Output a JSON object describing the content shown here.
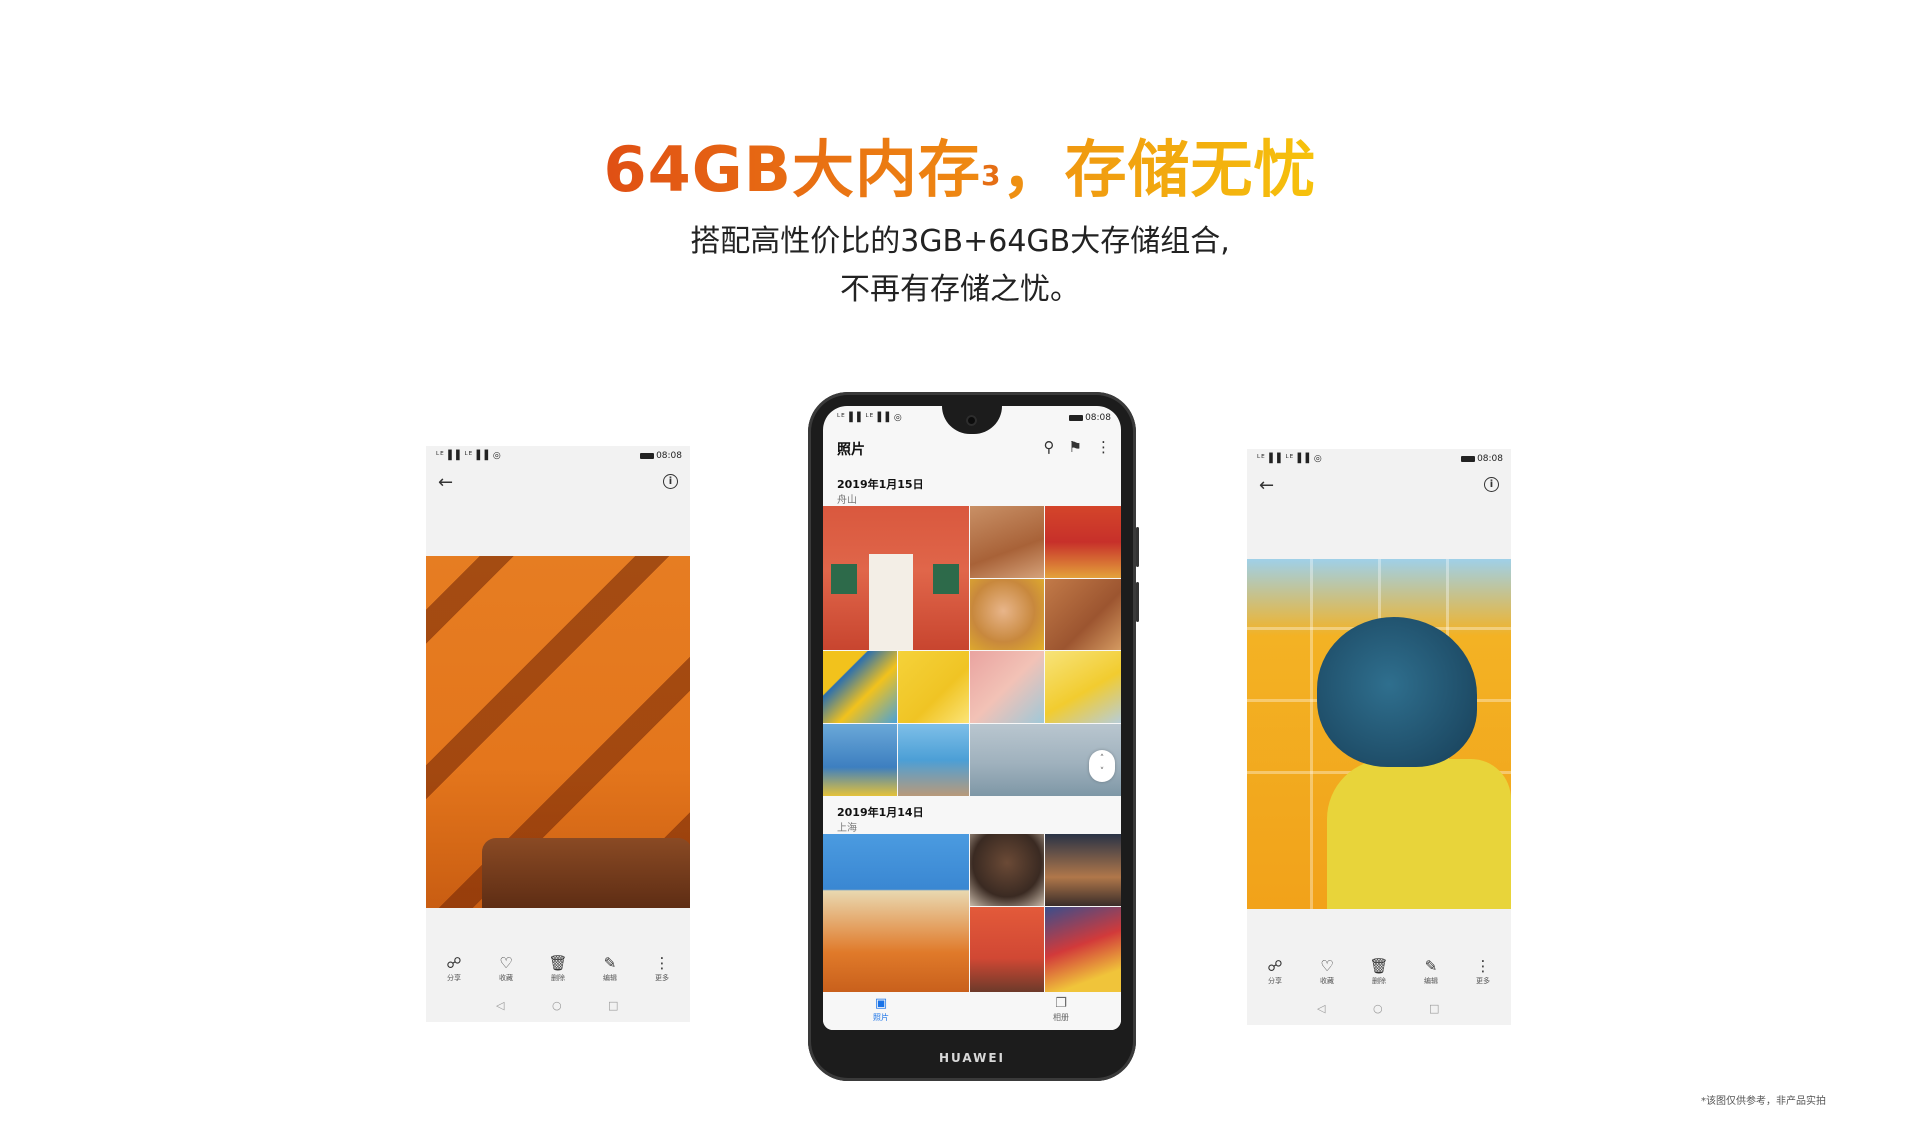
{
  "headline": {
    "part_a": "64GB大内存",
    "superscript": "3",
    "part_b": "，存储无忧"
  },
  "subtitle": {
    "line1": "搭配高性价比的3GB+64GB大存储组合,",
    "line2": "不再有存储之忧。"
  },
  "status_bar": {
    "signals": "ᴸᴱ▐▐ ᴸᴱ▐▐ ◎",
    "time": "08:08"
  },
  "gallery_app": {
    "title": "照片",
    "groups": [
      {
        "date": "2019年1月15日",
        "location": "舟山"
      },
      {
        "date": "2019年1月14日",
        "location": "上海"
      }
    ],
    "tabs": [
      {
        "label": "照片",
        "active": true
      },
      {
        "label": "相册",
        "active": false
      }
    ],
    "brand": "HUAWEI"
  },
  "photo_viewer_toolbar": [
    {
      "icon": "share-icon",
      "label": "分享"
    },
    {
      "icon": "heart-icon",
      "label": "收藏"
    },
    {
      "icon": "trash-icon",
      "label": "删除"
    },
    {
      "icon": "edit-icon",
      "label": "编辑"
    },
    {
      "icon": "more-icon",
      "label": "更多"
    }
  ],
  "disclaimer": "*该图仅供参考，非产品实拍",
  "colors": {
    "headline_orange": "#e05f16",
    "headline_yellow": "#f0a30f",
    "active_tab_blue": "#1a73e8"
  }
}
